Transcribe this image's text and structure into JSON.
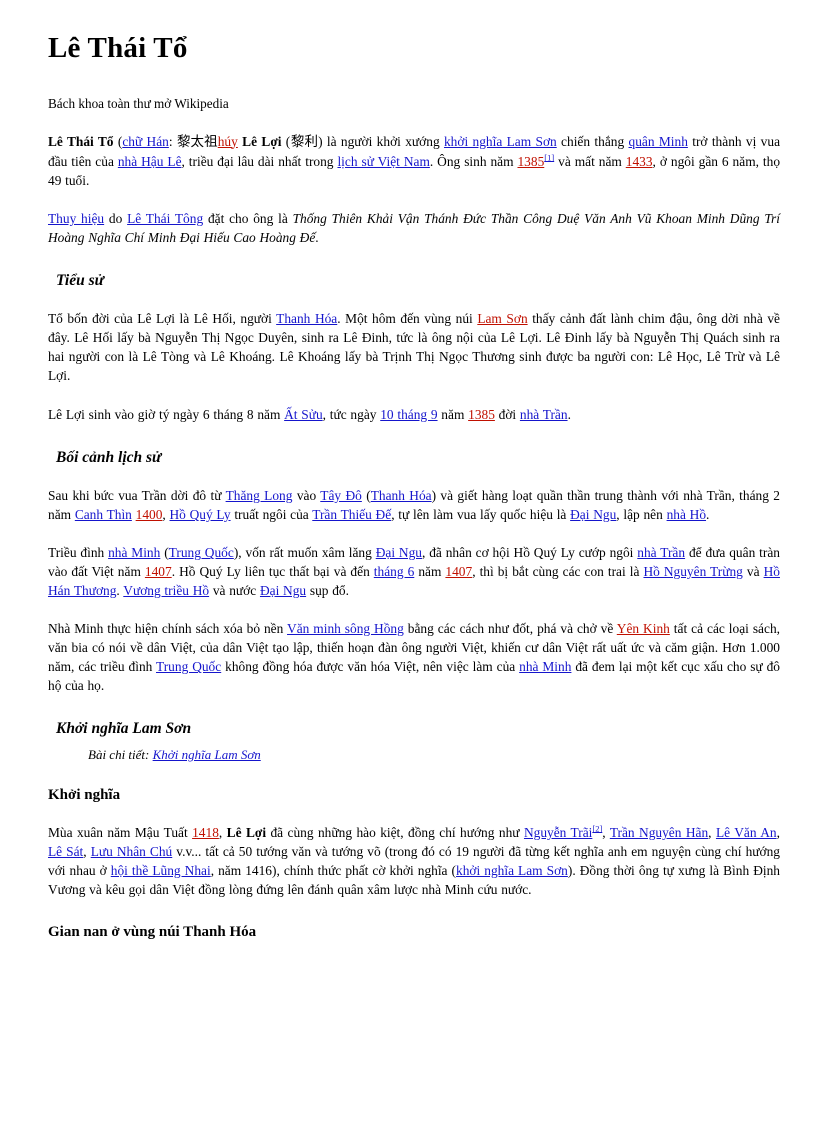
{
  "page": {
    "title": "Lê Thái Tổ",
    "subtitle": "Bách khoa toàn thư mở Wikipedia"
  },
  "colors": {
    "link_blue": "#1515cc",
    "link_red": "#c01000",
    "text": "#000000",
    "background": "#ffffff"
  },
  "intro": {
    "p1": {
      "s1": "Lê Thái Tổ",
      "s2": " (",
      "link_chu_han": "chữ Hán",
      "s3": ": ",
      "han1": "黎太祖",
      "link_huy": "húy",
      "s4": " ",
      "s5": "Lê Lợi",
      "s6": " (",
      "han2": "黎利",
      "s7": ") là người khởi xướng ",
      "link_khoi_nghia_lam_son": "khởi nghĩa Lam Sơn",
      "s8": " chiến thắng ",
      "link_quan_minh": "quân Minh",
      "s9": " trở thành vị vua đầu tiên của ",
      "link_nha_hau_le": "nhà Hậu Lê",
      "s10": ", triều đại lâu dài nhất trong ",
      "link_lich_su_viet_nam": "lịch sử Việt Nam",
      "s11": ". Ông sinh năm ",
      "link_1385": "1385",
      "ref1": "[1]",
      "s12": " và mất năm ",
      "link_1433": "1433",
      "s13": ", ở ngôi gần 6 năm, thọ 49 tuổi."
    },
    "p2": {
      "link_thuy_hieu": "Thuy hiệu",
      "s1": " do ",
      "link_le_thai_tong": "Lê Thái Tông",
      "s2": " đặt cho ông là ",
      "regnal_name": "Thống Thiên Khải Vận Thánh Đức Thần Công Duệ Văn Anh Vũ Khoan Minh Dũng Trí Hoàng Nghĩa Chí Minh Đại Hiếu Cao Hoàng Đế",
      "s3": "."
    }
  },
  "sections": [
    {
      "heading": "Tiểu sử",
      "style": "italic",
      "paragraphs": [
        {
          "s1": "Tổ bốn đời của Lê Lợi là Lê Hối, người ",
          "link_thanh_hoa": "Thanh Hóa",
          "s2": ". Một hôm đến vùng núi ",
          "link_lam_son": "Lam Sơn",
          "s3": " thấy cảnh đất lành chim đậu, ông dời nhà về đây. Lê Hối lấy bà Nguyễn Thị Ngọc Duyên, sinh ra Lê Đinh, tức là ông nội của Lê Lợi. Lê Đinh lấy bà Nguyễn Thị Quách sinh ra hai người con là Lê Tòng và Lê Khoáng. Lê Khoáng lấy bà Trịnh Thị Ngọc Thương sinh được ba người con: Lê Học, Lê Trừ và Lê Lợi."
        },
        {
          "s1": "Lê Lợi sinh vào giờ tý ngày 6 tháng 8 năm ",
          "link_at_suu": "Ất Sửu",
          "s2": ", tức ngày ",
          "link_10_thang_9": "10 tháng 9",
          "s3": " năm ",
          "link_1385": "1385",
          "s4": " đời ",
          "link_nha_tran": "nhà Trần",
          "s5": "."
        }
      ]
    },
    {
      "heading": "Bối cảnh lịch sử",
      "style": "italic",
      "paragraphs": [
        {
          "s1": "Sau khi bức vua Trần dời đô từ ",
          "link_thang_long": "Thăng Long",
          "s2": " vào ",
          "link_tay_do": "Tây Đô",
          "s3": " (",
          "link_thanh_hoa": "Thanh Hóa",
          "s4": ") và giết hàng loạt quần thần trung thành với nhà Trần, tháng 2 năm ",
          "link_canh_thin": "Canh Thìn",
          "s5": " ",
          "link_1400": "1400",
          "s6": ", ",
          "link_ho_quy_ly": "Hồ Quý Ly",
          "s7": " truất ngôi của ",
          "link_tran_thieu_de": "Trần Thiếu Đế",
          "s8": ", tự lên làm vua lấy quốc hiệu là ",
          "link_dai_ngu": "Đại Ngu",
          "s9": ", lập nên ",
          "link_nha_ho": "nhà Hồ",
          "s10": "."
        },
        {
          "s1": "Triều đình ",
          "link_nha_minh": "nhà Minh",
          "s2": " (",
          "link_trung_quoc": "Trung Quốc",
          "s3": "), vốn rất muốn xâm lăng ",
          "link_dai_ngu": "Đại Ngu",
          "s4": ", đã nhân cơ hội Hồ Quý Ly cướp ngôi ",
          "link_nha_tran": "nhà Trần",
          "s5": " để đưa quân tràn vào đất Việt năm ",
          "link_1407a": "1407",
          "s6": ". Hồ Quý Ly liên tục thất bại và đến ",
          "link_thang_6": "tháng 6",
          "s7": " năm ",
          "link_1407b": "1407",
          "s8": ", thì bị bắt cùng các con trai là ",
          "link_ho_nguyen_trung": "Hồ Nguyên Trừng",
          "s9": " và ",
          "link_ho_han_thuong": "Hồ Hán Thương",
          "s10": ". ",
          "link_vuong_trieu_ho": "Vương triều Hồ",
          "s11": " và nước ",
          "link_dai_ngu2": "Đại Ngu",
          "s12": " sụp đổ."
        },
        {
          "s1": "Nhà Minh thực hiện chính sách xóa bỏ nền ",
          "link_van_minh_song_hong": "Văn minh sông Hồng",
          "s2": " bằng các cách như đốt, phá và chở về ",
          "link_yen_kinh": "Yên Kinh",
          "s3": " tất cả các loại sách, văn bia có nói về dân Việt, của dân Việt tạo lập, thiến hoạn đàn ông người Việt, khiến cư dân Việt rất uất ức và căm giận. Hơn 1.000 năm, các triều đình ",
          "link_trung_quoc": "Trung Quốc",
          "s4": " không đồng hóa được văn hóa Việt, nên việc làm của ",
          "link_nha_minh": "nhà Minh",
          "s5": " đã đem lại một kết cục xấu cho sự đô hộ của họ."
        }
      ]
    }
  ],
  "lamson": {
    "heading": "Khởi nghĩa Lam Sơn",
    "seealso_label": "Bài chi tiết:",
    "seealso_link": "Khởi nghĩa Lam Sơn",
    "subheading": "Khởi nghĩa",
    "paragraph": {
      "s1": "Mùa xuân năm Mậu Tuất ",
      "link_1418": "1418",
      "s2": ", ",
      "bold_le_loi": "Lê Lợi",
      "s3": " đã cùng những hào kiệt, đồng chí hướng như ",
      "link_nguyen_trai": "Nguyễn Trãi",
      "ref2": "[2]",
      "s4": ", ",
      "link_tran_nguyen_han": "Trần Nguyên Hãn",
      "s5": ", ",
      "link_le_van_an": "Lê Văn An",
      "s6": ", ",
      "link_le_sat": "Lê Sát",
      "s7": ", ",
      "link_luu_nhan_chu": "Lưu Nhân Chú",
      "s8": " v.v... tất cả 50 tướng văn và tướng võ (trong đó có 19 người đã từng kết nghĩa anh em nguyện cùng chí hướng với nhau ở ",
      "link_hoi_the_lung_nhai": "hội thề Lũng Nhai",
      "s9": ", năm 1416), chính thức phất cờ khởi nghĩa (",
      "link_khoi_nghia_lam_son": "khởi nghĩa Lam Sơn",
      "s10": "). Đồng thời ông tự xưng là Bình Định Vương và kêu gọi dân Việt đồng lòng đứng lên đánh quân xâm lược nhà Minh cứu nước."
    }
  },
  "final_heading": "Gian nan ở vùng núi Thanh Hóa"
}
